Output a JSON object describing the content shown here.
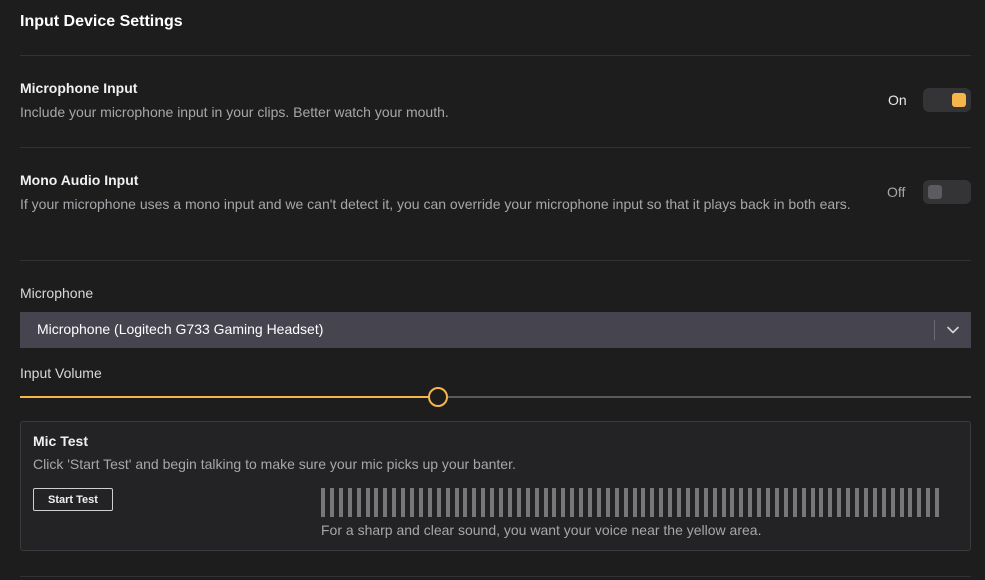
{
  "page": {
    "title": "Input Device Settings"
  },
  "settings": {
    "microphone_input": {
      "title": "Microphone Input",
      "description": "Include your microphone input in your clips. Better watch your mouth.",
      "state_label": "On",
      "enabled": true
    },
    "mono_audio_input": {
      "title": "Mono Audio Input",
      "description": "If your microphone uses a mono input and we can't detect it, you can override your microphone input so that it plays back in both ears.",
      "state_label": "Off",
      "enabled": false
    }
  },
  "microphone": {
    "label": "Microphone",
    "selected": "Microphone (Logitech G733 Gaming Headset)"
  },
  "input_volume": {
    "label": "Input Volume",
    "value_percent": 44
  },
  "mic_test": {
    "title": "Mic Test",
    "description": "Click 'Start Test' and begin talking to make sure your mic picks up your banter.",
    "button_label": "Start Test",
    "hint": "For a sharp and clear sound, you want your voice near the yellow area."
  },
  "colors": {
    "accent": "#f5b54a",
    "background": "#1d1d1e",
    "select_background": "#45444f"
  },
  "icons": {
    "dropdown": "chevron-down-icon"
  }
}
